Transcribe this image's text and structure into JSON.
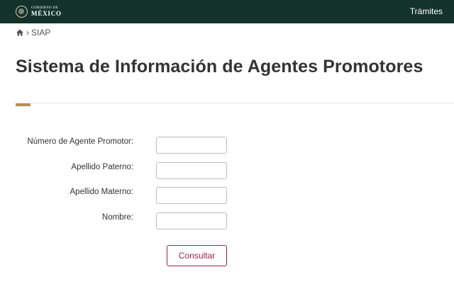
{
  "header": {
    "logo_line1": "GOBIERNO DE",
    "logo_line2": "MÉXICO",
    "nav_link": "Trámites"
  },
  "breadcrumb": {
    "home_icon": "home-icon",
    "current": "SIAP"
  },
  "page": {
    "title": "Sistema de Información de Agentes Promotores"
  },
  "form": {
    "fields": [
      {
        "label": "Número de Agente Promotor:",
        "value": ""
      },
      {
        "label": "Apellido Paterno:",
        "value": ""
      },
      {
        "label": "Apellido Materno:",
        "value": ""
      },
      {
        "label": "Nombre:",
        "value": ""
      }
    ],
    "submit_label": "Consultar"
  },
  "colors": {
    "header_bg": "#13322b",
    "accent": "#b38e5d",
    "button": "#9d2449"
  }
}
